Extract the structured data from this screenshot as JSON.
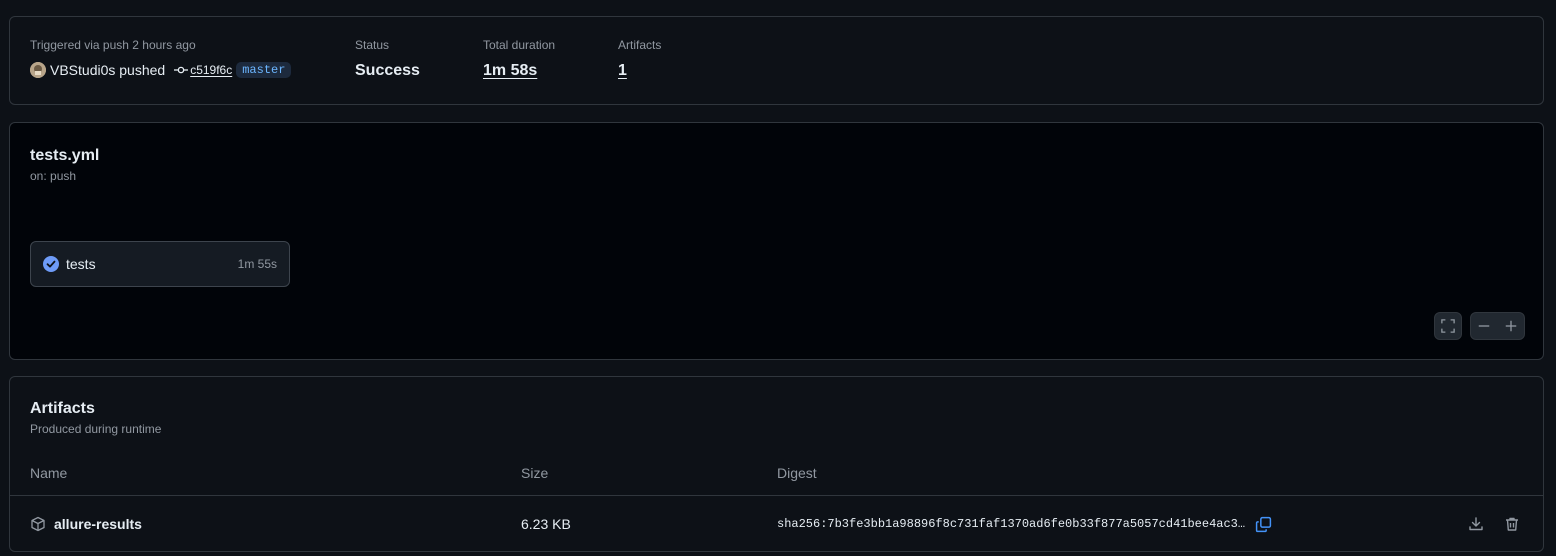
{
  "summary": {
    "trigger_label": "Triggered via push 2 hours ago",
    "actor": "VBStudi0s pushed",
    "commit_sha": "c519f6c",
    "branch": "master",
    "status_label": "Status",
    "status_value": "Success",
    "duration_label": "Total duration",
    "duration_value": "1m 58s",
    "artifacts_label": "Artifacts",
    "artifacts_value": "1"
  },
  "workflow": {
    "file": "tests.yml",
    "trigger": "on: push",
    "jobs": [
      {
        "name": "tests",
        "duration": "1m 55s",
        "status": "success"
      }
    ]
  },
  "artifacts": {
    "title": "Artifacts",
    "subtitle": "Produced during runtime",
    "columns": [
      "Name",
      "Size",
      "Digest"
    ],
    "rows": [
      {
        "name": "allure-results",
        "size": "6.23 KB",
        "digest": "sha256:7b3fe3bb1a98896f8c731faf1370ad6fe0b33f877a5057cd41bee4ac3…"
      }
    ]
  },
  "colors": {
    "background": "#0d1117",
    "border": "#30363d",
    "accent_blue": "#4493f8",
    "success_icon": "#6e9bf7",
    "muted_text": "#9198a1"
  }
}
